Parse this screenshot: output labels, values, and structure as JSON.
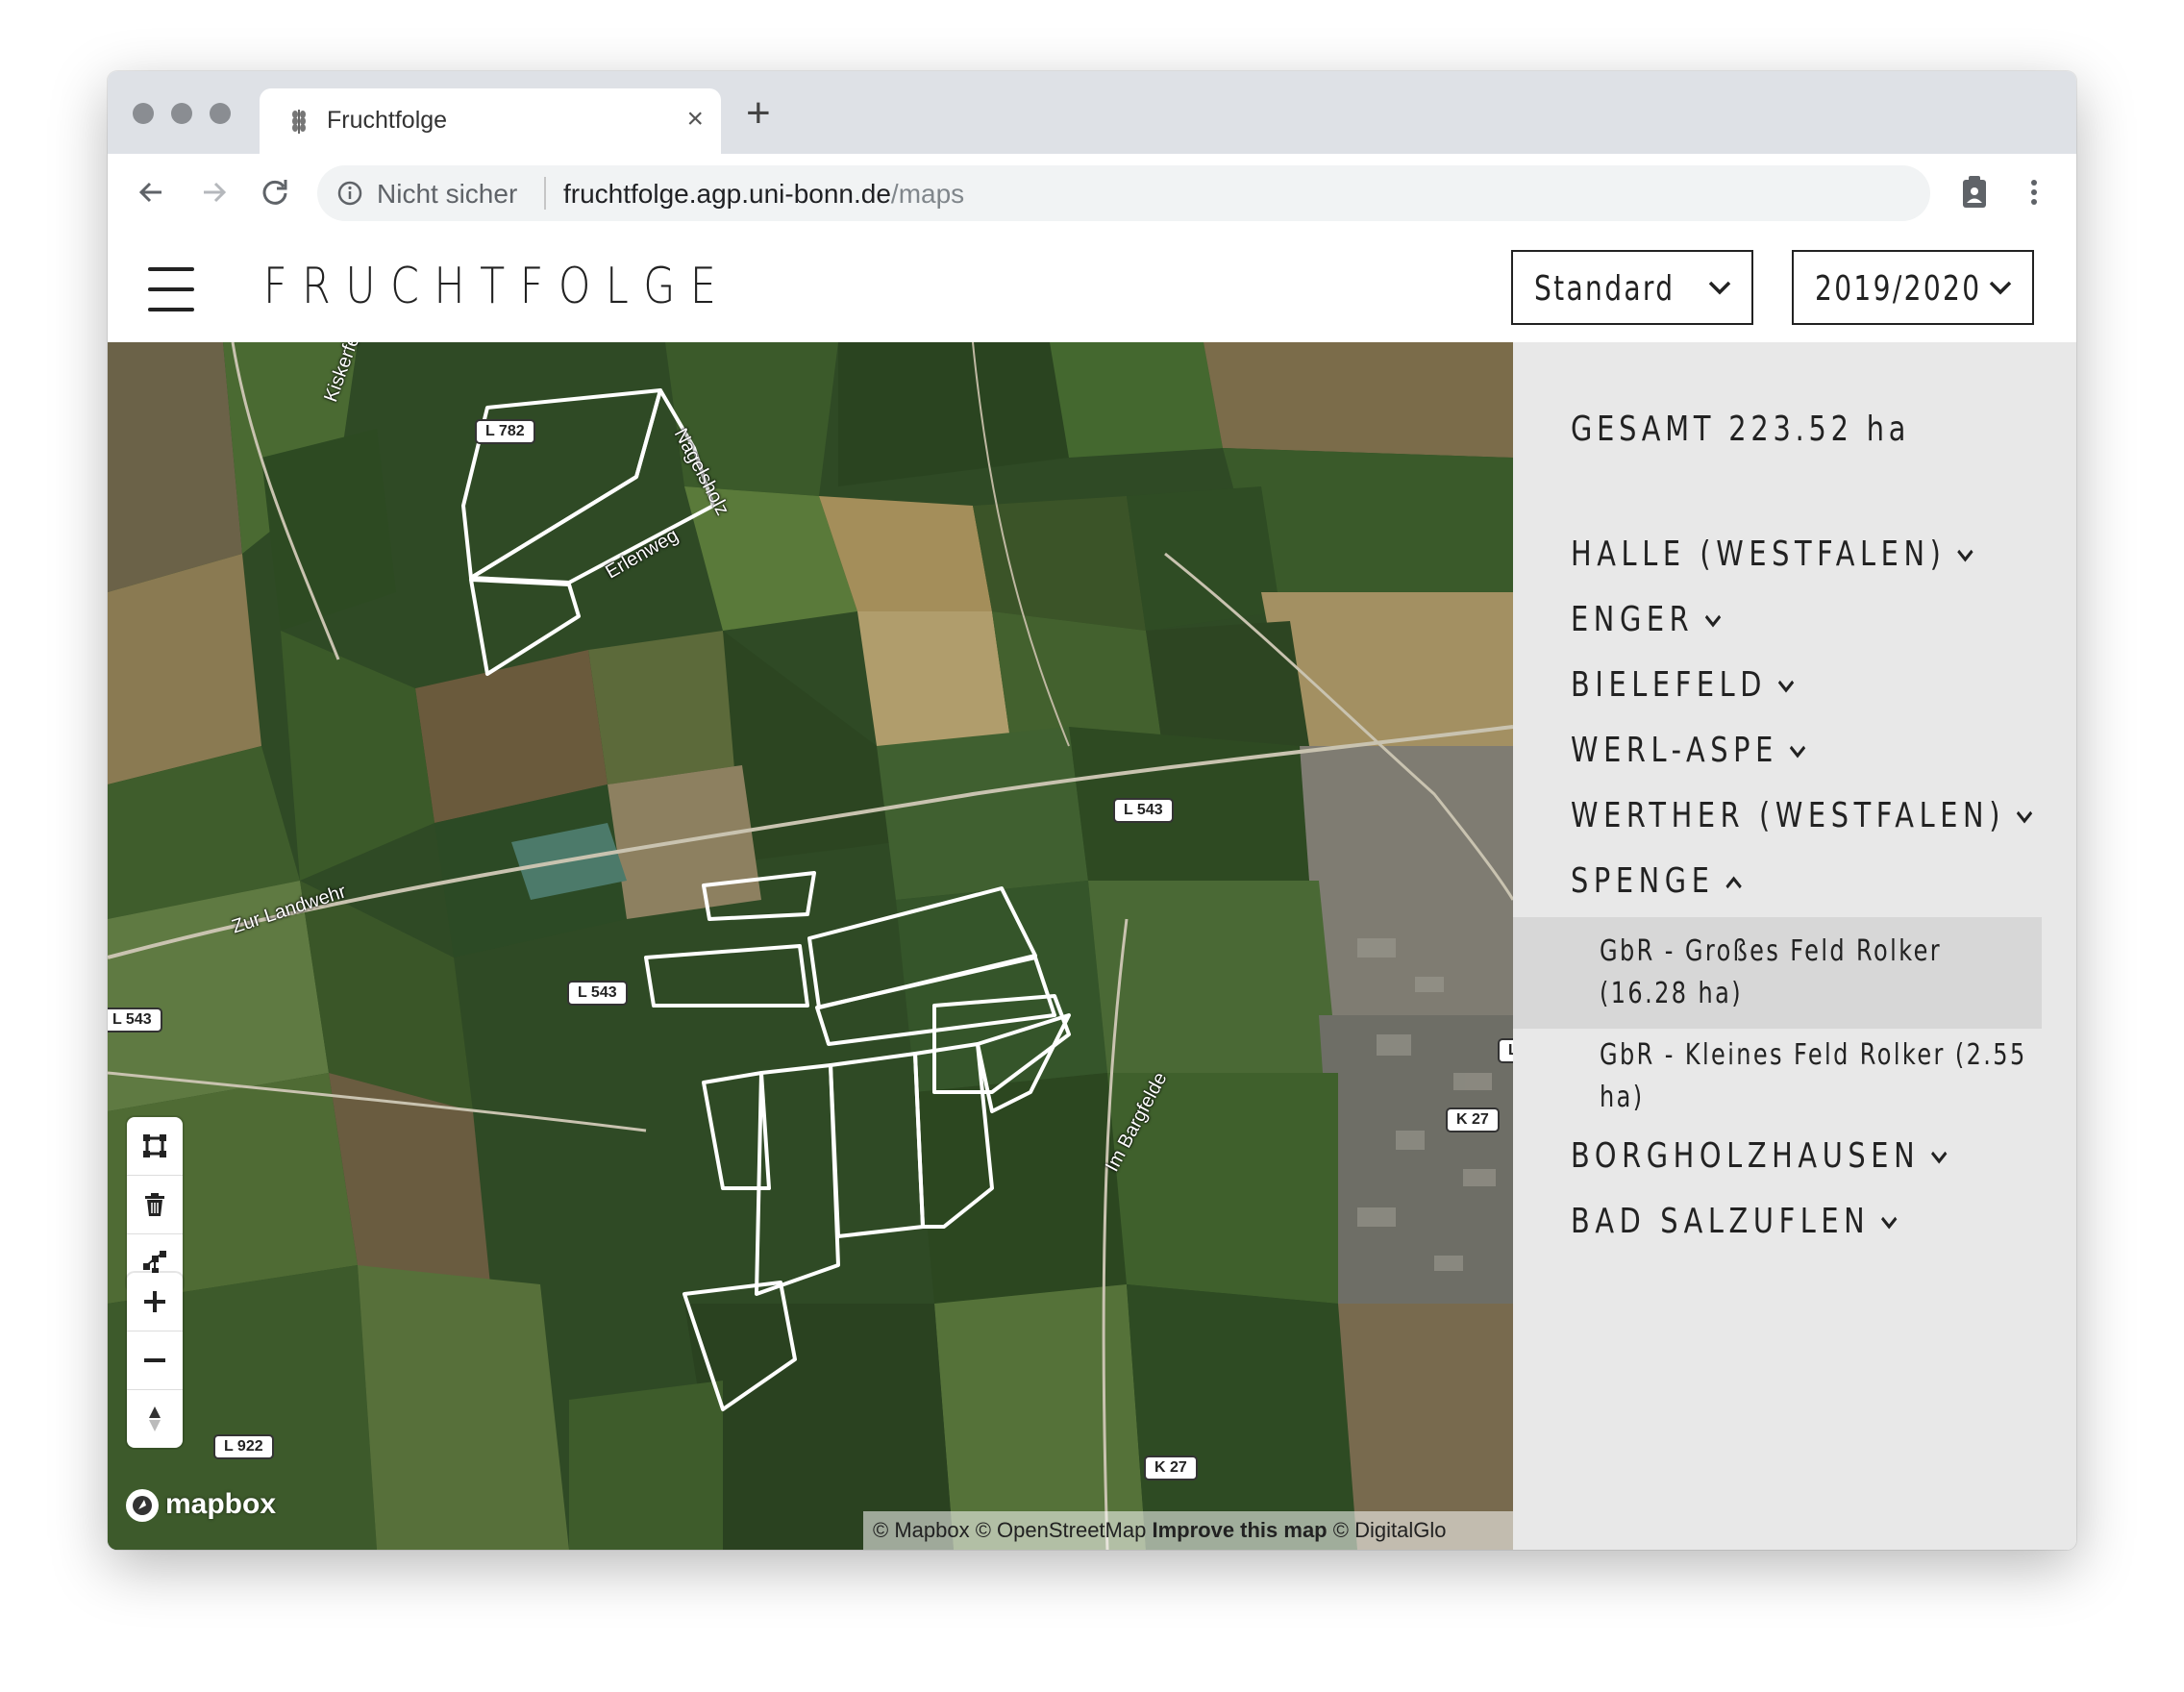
{
  "browser": {
    "tab_title": "Fruchtfolge",
    "tab_close": "×",
    "new_tab": "+",
    "security_label": "Nicht sicher",
    "url_host": "fruchtfolge.agp.uni-bonn.de",
    "url_path": "/maps"
  },
  "header": {
    "title": "FRUCHTFOLGE",
    "view_select": {
      "selected": "Standard"
    },
    "year_select": {
      "selected": "2019/2020"
    }
  },
  "map": {
    "road_labels": [
      "L 782",
      "L 543",
      "L 543",
      "L 543",
      "K 27",
      "K 27",
      "L 922",
      "L"
    ],
    "street_labels": [
      "Kiskerfeld",
      "Nagelsholz",
      "Erlenweg",
      "Zur Landwehr",
      "Im Bargfelde"
    ],
    "logo_text": "mapbox",
    "attribution": {
      "part1": "© Mapbox © OpenStreetMap",
      "improve": "Improve this map",
      "part2": "© DigitalGlo"
    },
    "controls": [
      "polygon-draw-icon",
      "trash-icon",
      "combine-icon",
      "zoom-in-icon",
      "zoom-out-icon",
      "compass-icon"
    ]
  },
  "sidebar": {
    "total": "GESAMT 223.52 ha",
    "locations": [
      {
        "name": "HALLE (WESTFALEN)",
        "expanded": false
      },
      {
        "name": "ENGER",
        "expanded": false
      },
      {
        "name": "BIELEFELD",
        "expanded": false
      },
      {
        "name": "WERL-ASPE",
        "expanded": false
      },
      {
        "name": "WERTHER (WESTFALEN)",
        "expanded": false
      },
      {
        "name": "SPENGE",
        "expanded": true
      },
      {
        "name": "BORGHOLZHAUSEN",
        "expanded": false
      },
      {
        "name": "BAD SALZUFLEN",
        "expanded": false
      }
    ],
    "spenge_fields": [
      {
        "label": "GbR - Großes Feld Rolker (16.28 ha)",
        "selected": true
      },
      {
        "label": "GbR - Kleines Feld Rolker (2.55 ha)",
        "selected": false
      }
    ]
  },
  "colors": {
    "map_base": "#2f4a25",
    "sidebar_bg": "#e8e8e8",
    "selected_row": "#d7d7d7",
    "field_outline": "#ffffff"
  }
}
